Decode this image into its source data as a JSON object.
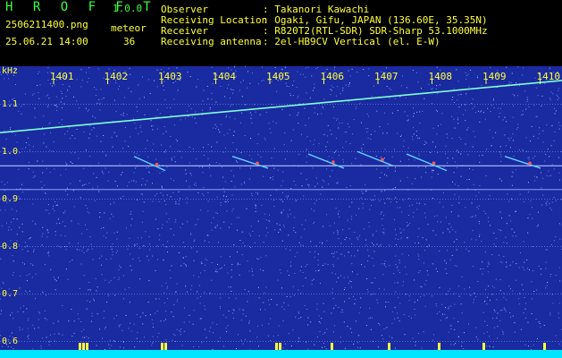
{
  "header": {
    "app_name": "H R O F F T",
    "version": "1.0.0",
    "filename": "2506211400.png",
    "datetime": "25.06.21 14:00",
    "meteor_label": "meteor",
    "meteor_count": "36",
    "fields": [
      {
        "label": "Observer",
        "value": ": Takanori Kawachi"
      },
      {
        "label": "Receiving Location",
        "value": ": Ogaki, Gifu, JAPAN (136.60E, 35.35N)"
      },
      {
        "label": "Receiver",
        "value": ": R820T2(RTL-SDR) SDR-Sharp 53.1000MHz"
      },
      {
        "label": "Receiving antenna",
        "value": ": 2el-HB9CV Vertical (el. E-W)"
      }
    ]
  },
  "chart_data": {
    "type": "heatmap",
    "ylabel": "kHz",
    "x_ticks": [
      "1401",
      "1402",
      "1403",
      "1404",
      "1405",
      "1406",
      "1407",
      "1408",
      "1409",
      "1410"
    ],
    "y_ticks": [
      "1.1",
      "1.0",
      "0.9",
      "0.8",
      "0.7",
      "0.6"
    ],
    "y_tick_values": [
      1.1,
      1.0,
      0.9,
      0.8,
      0.7,
      0.6
    ],
    "ylim": [
      0.58,
      1.18
    ],
    "colors": {
      "background": "#1a2aa0",
      "noise": "#6a8cff",
      "trace": "#7fffd4",
      "meteor_core": "#ff5a5a",
      "grid": "#9ab0ff",
      "baseline": "#00e5ff",
      "spikes": "#ffff3c"
    }
  }
}
